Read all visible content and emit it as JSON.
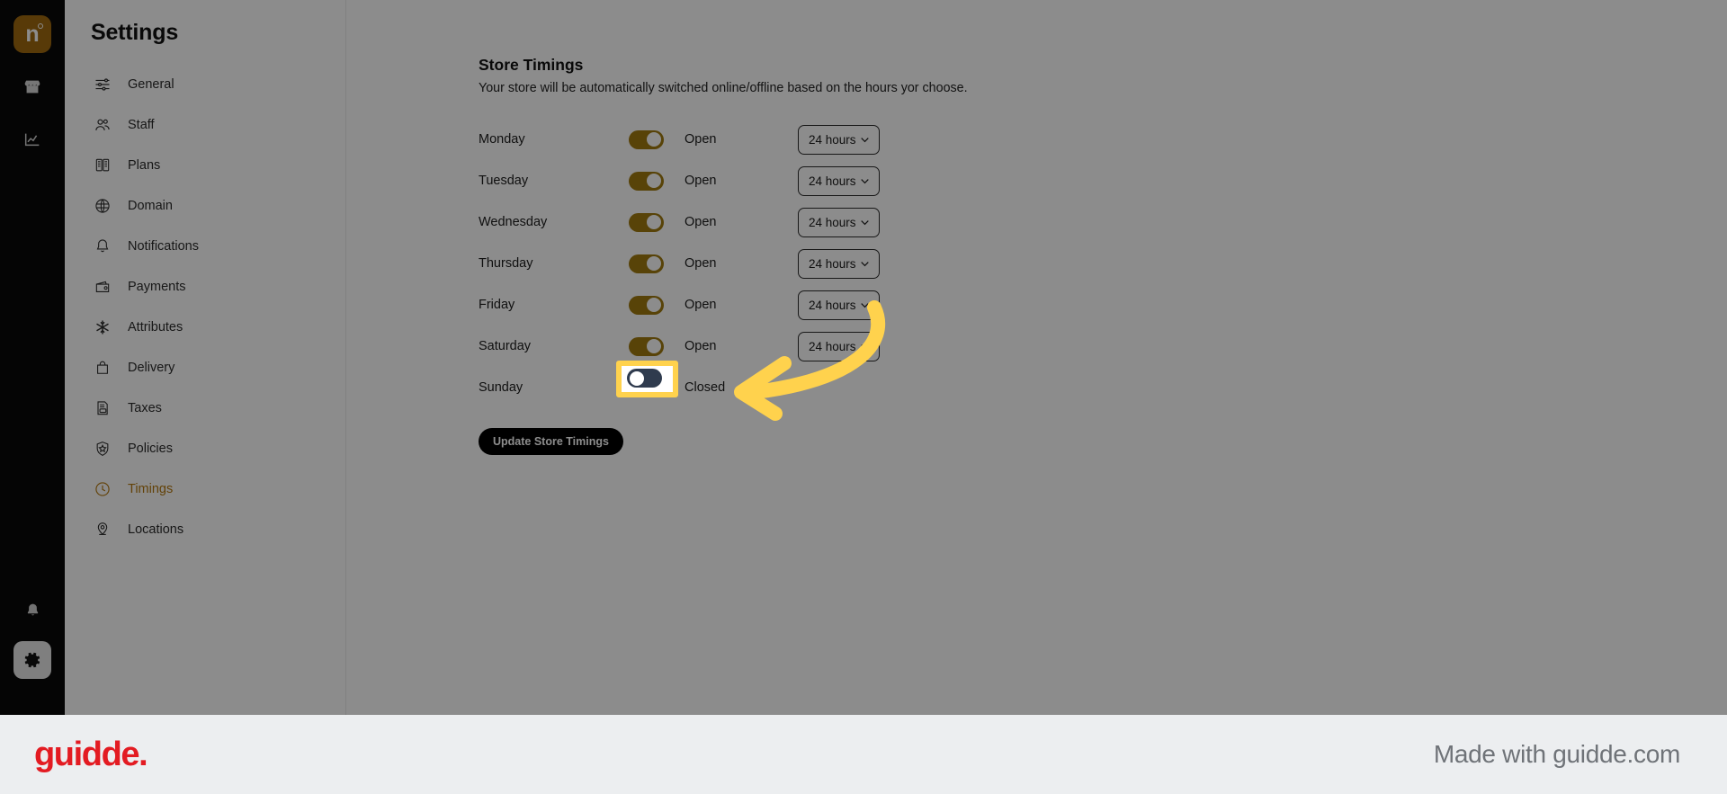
{
  "rail": {
    "logo_letter": "n",
    "icons": [
      {
        "name": "store-icon"
      },
      {
        "name": "analytics-icon"
      }
    ],
    "bottom_icons": [
      {
        "name": "bell-icon"
      },
      {
        "name": "gear-icon"
      }
    ]
  },
  "sidebar": {
    "title": "Settings",
    "items": [
      {
        "label": "General",
        "icon": "sliders-icon",
        "active": false
      },
      {
        "label": "Staff",
        "icon": "people-icon",
        "active": false
      },
      {
        "label": "Plans",
        "icon": "plans-book-icon",
        "active": false
      },
      {
        "label": "Domain",
        "icon": "globe-icon",
        "active": false
      },
      {
        "label": "Notifications",
        "icon": "bell-icon",
        "active": false
      },
      {
        "label": "Payments",
        "icon": "wallet-icon",
        "active": false
      },
      {
        "label": "Attributes",
        "icon": "asterisk-icon",
        "active": false
      },
      {
        "label": "Delivery",
        "icon": "bag-icon",
        "active": false
      },
      {
        "label": "Taxes",
        "icon": "tax-document-icon",
        "active": false
      },
      {
        "label": "Policies",
        "icon": "shield-star-icon",
        "active": false
      },
      {
        "label": "Timings",
        "icon": "clock-icon",
        "active": true
      },
      {
        "label": "Locations",
        "icon": "location-pin-icon",
        "active": false
      }
    ]
  },
  "main": {
    "section_title": "Store Timings",
    "section_subtitle": "Your store will be automatically switched online/offline based on the hours yor choose.",
    "days": [
      {
        "day": "Monday",
        "open": true,
        "state_label": "Open",
        "hours": "24 hours"
      },
      {
        "day": "Tuesday",
        "open": true,
        "state_label": "Open",
        "hours": "24 hours"
      },
      {
        "day": "Wednesday",
        "open": true,
        "state_label": "Open",
        "hours": "24 hours"
      },
      {
        "day": "Thursday",
        "open": true,
        "state_label": "Open",
        "hours": "24 hours"
      },
      {
        "day": "Friday",
        "open": true,
        "state_label": "Open",
        "hours": "24 hours"
      },
      {
        "day": "Saturday",
        "open": true,
        "state_label": "Open",
        "hours": "24 hours"
      },
      {
        "day": "Sunday",
        "open": false,
        "state_label": "Closed",
        "hours": ""
      }
    ],
    "update_button": "Update Store Timings"
  },
  "annotation": {
    "highlight_target": "sunday-open-toggle",
    "highlight_color": "#ffd24d",
    "arrow_color": "#ffd24d"
  },
  "guidde": {
    "logo": "guidde.",
    "made_with": "Made with guidde.com",
    "logo_color": "#e31b22"
  }
}
